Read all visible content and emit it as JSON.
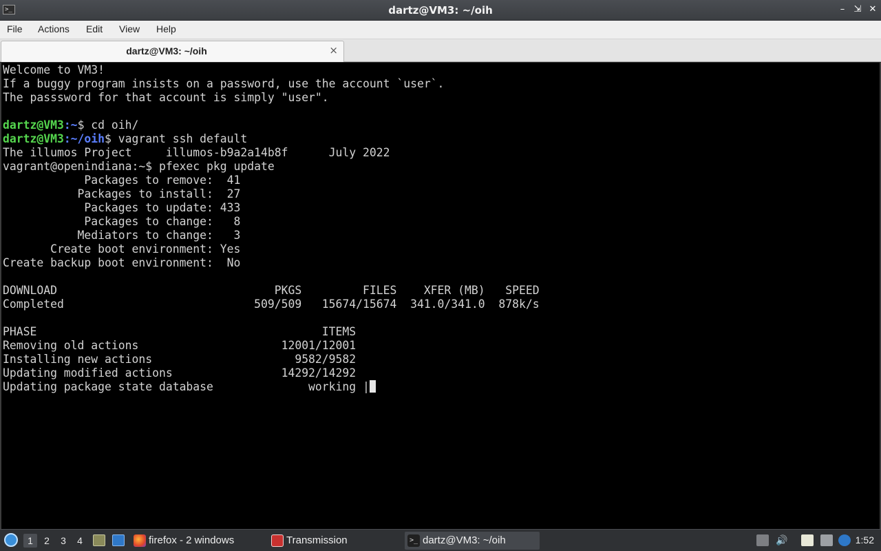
{
  "window": {
    "title": "dartz@VM3: ~/oih",
    "app_icon": "terminal-icon",
    "controls": [
      "minimize-icon",
      "maximize-icon",
      "close-icon"
    ]
  },
  "menubar": {
    "items": [
      "File",
      "Actions",
      "Edit",
      "View",
      "Help"
    ]
  },
  "tabs": [
    {
      "label": "dartz@VM3: ~/oih",
      "close_glyph": "×"
    }
  ],
  "terminal": {
    "lines": [
      "Welcome to VM3!",
      "If a buggy program insists on a password, use the account `user`.",
      "The passsword for that account is simply \"user\".",
      "",
      {
        "user": "dartz@VM3",
        "path": ":~",
        "cmd": "$ cd oih/"
      },
      {
        "user": "dartz@VM3",
        "path": ":~/oih",
        "cmd": "$ vagrant ssh default"
      },
      "The illumos Project     illumos-b9a2a14b8f      July 2022",
      "vagrant@openindiana:~$ pfexec pkg update",
      "            Packages to remove:  41",
      "           Packages to install:  27",
      "            Packages to update: 433",
      "            Packages to change:   8",
      "           Mediators to change:   3",
      "       Create boot environment: Yes",
      "Create backup boot environment:  No",
      "",
      "DOWNLOAD                                PKGS         FILES    XFER (MB)   SPEED",
      "Completed                            509/509   15674/15674  341.0/341.0  878k/s",
      "",
      "PHASE                                          ITEMS",
      "Removing old actions                     12001/12001",
      "Installing new actions                     9582/9582",
      "Updating modified actions                14292/14292",
      {
        "text": "Updating package state database              working |",
        "cursor": true
      }
    ],
    "colors": {
      "background": "#000000",
      "foreground": "#d3d3d3",
      "user": "#55d64e",
      "path": "#5b7fff"
    }
  },
  "taskbar": {
    "start_icon": "start-menu-icon",
    "workspaces": [
      "1",
      "2",
      "3",
      "4"
    ],
    "active_workspace": "1",
    "launchers": [
      "file-manager-icon",
      "show-desktop-icon"
    ],
    "tasks": [
      {
        "label": "firefox - 2 windows",
        "icon": "firefox-icon",
        "active": false
      },
      {
        "label": "Transmission",
        "icon": "transmission-icon",
        "active": false
      },
      {
        "label": "dartz@VM3: ~/oih",
        "icon": "terminal-icon",
        "active": true
      }
    ],
    "tray": [
      "clipboard-icon",
      "volume-icon",
      "files-icon",
      "network-icon",
      "notification-icon"
    ],
    "clock": "1:52"
  }
}
